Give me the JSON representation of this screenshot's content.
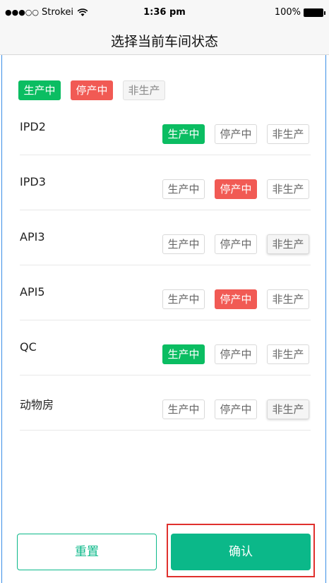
{
  "status_bar": {
    "signal_dots": "●●●○○",
    "carrier": "Strokei",
    "time": "1:36 pm",
    "battery": "100%"
  },
  "header": {
    "title": "选择当前车间状态"
  },
  "legend": {
    "producing": "生产中",
    "stopped": "停产中",
    "non_production": "非生产"
  },
  "workshops": [
    {
      "name": "IPD2",
      "selected": "producing",
      "labels": [
        "生产中",
        "停产中",
        "非生产"
      ]
    },
    {
      "name": "IPD3",
      "selected": "stopped",
      "labels": [
        "生产中",
        "停产中",
        "非生产"
      ]
    },
    {
      "name": "API3",
      "selected": "non_production",
      "labels": [
        "生产中",
        "停产中",
        "非生产"
      ]
    },
    {
      "name": "API5",
      "selected": "stopped",
      "labels": [
        "生产中",
        "停产中",
        "非生产"
      ]
    },
    {
      "name": "QC",
      "selected": "producing",
      "labels": [
        "生产中",
        "停产中",
        "非生产"
      ]
    },
    {
      "name": "动物房",
      "selected": "non_production",
      "labels": [
        "生产中",
        "停产中",
        "非生产"
      ]
    }
  ],
  "footer": {
    "reset_label": "重置",
    "confirm_label": "确认"
  },
  "colors": {
    "producing": "#0bbd62",
    "stopped": "#f15a54",
    "non_production": "#f5f5f5",
    "accent": "#0bb889",
    "highlight_frame": "#e0302d"
  }
}
